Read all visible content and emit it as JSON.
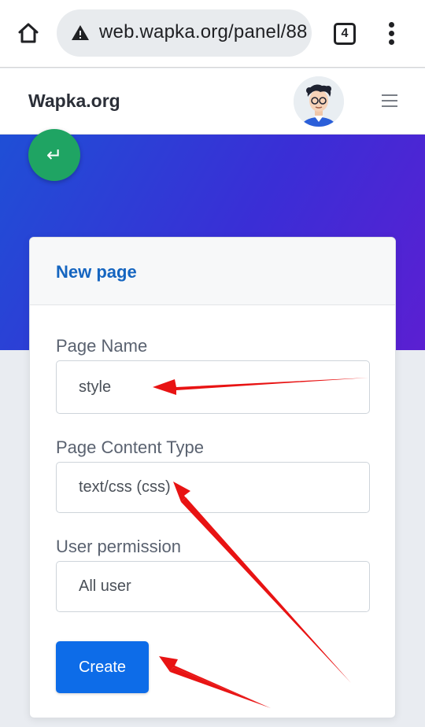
{
  "browser": {
    "url": "web.wapka.org/panel/88",
    "tab_count": "4",
    "icons": {
      "home": "home-icon",
      "warning": "warning-icon",
      "menu": "more-vert-icon"
    }
  },
  "site": {
    "brand": "Wapka.org",
    "back_icon": "↵"
  },
  "form": {
    "title": "New page",
    "fields": [
      {
        "label": "Page Name",
        "value": "style"
      },
      {
        "label": "Page Content Type",
        "value": "text/css (css)"
      },
      {
        "label": "User permission",
        "value": "All user"
      }
    ],
    "submit_label": "Create"
  },
  "colors": {
    "accent": "#0d6ce8",
    "title": "#1565c0",
    "fab": "#1fa463",
    "annotation": "#e81313",
    "hero_start": "#1f4fd6",
    "hero_end": "#5b1fd2"
  }
}
